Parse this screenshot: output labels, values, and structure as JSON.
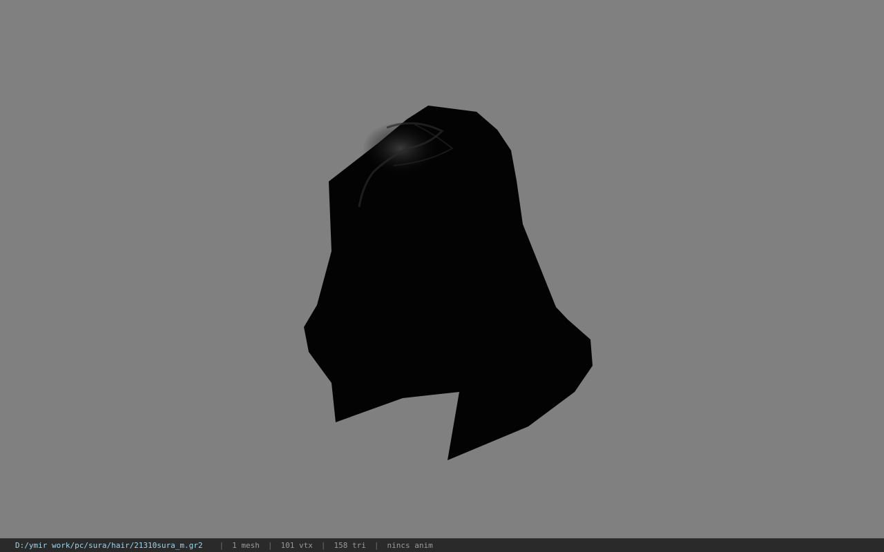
{
  "viewport": {
    "background": "#808080",
    "model_color": "#030303",
    "model_name": "hair-mesh"
  },
  "statusbar": {
    "file_path": "D:/ymir work/pc/sura/hair/21310sura_m.gr2",
    "separator": "|",
    "mesh_count": "1 mesh",
    "vertex_count": "101 vtx",
    "triangle_count": "158 tri",
    "anim_status": "nincs anim"
  }
}
